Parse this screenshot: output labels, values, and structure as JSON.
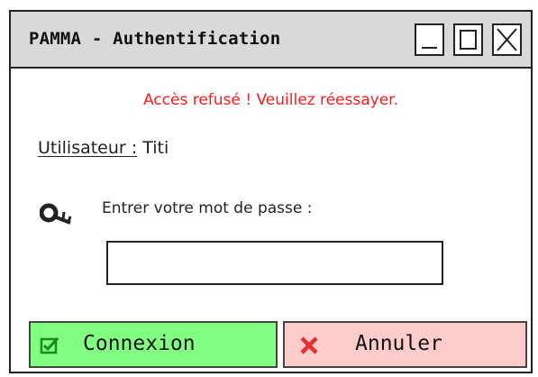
{
  "window": {
    "title": "PAMMA - Authentification"
  },
  "titlebar_buttons": {
    "minimize_icon": "minimize-icon",
    "maximize_icon": "maximize-icon",
    "close_icon": "close-icon"
  },
  "error": {
    "message": "Accès refusé ! Veuillez réessayer.",
    "color": "#ff1a1a"
  },
  "user": {
    "label": "Utilisateur :",
    "value": "Titi"
  },
  "password": {
    "icon": "key-icon",
    "label": "Entrer votre mot de passe :",
    "value": "",
    "placeholder": ""
  },
  "buttons": {
    "connect": {
      "label": "Connexion",
      "icon": "checkbox-icon",
      "color": "#80ff80"
    },
    "cancel": {
      "label": "Annuler",
      "icon": "cross-icon",
      "color": "#ffcccc"
    }
  }
}
